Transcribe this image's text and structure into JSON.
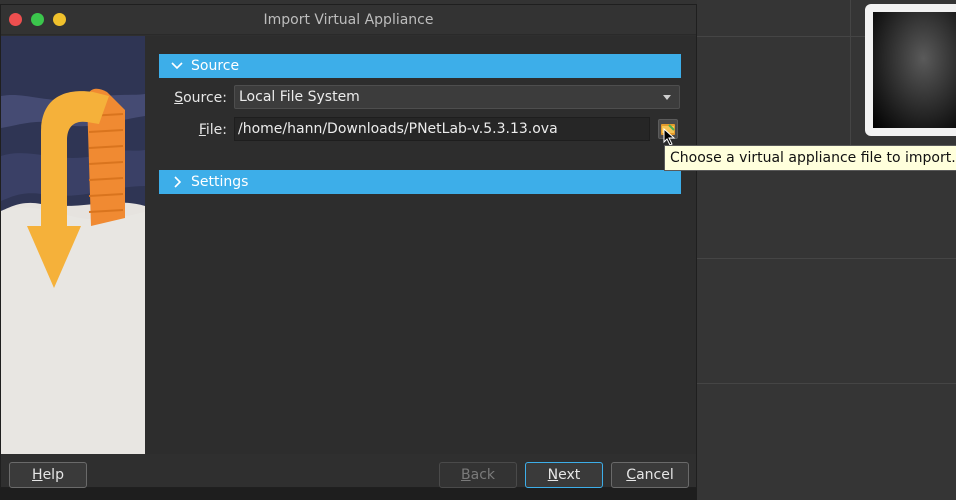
{
  "window": {
    "title": "Import Virtual Appliance"
  },
  "sections": {
    "source": {
      "header": "Source",
      "source_label": "Source:",
      "source_label_mnemonic": "S",
      "source_label_rest": "ource:",
      "source_value": "Local File System",
      "file_label": "File:",
      "file_label_mnemonic": "F",
      "file_label_rest": "ile:",
      "file_value": "/home/hann/Downloads/PNetLab-v.5.3.13.ova"
    },
    "settings": {
      "header": "Settings"
    }
  },
  "tooltip": {
    "text": "Choose a virtual appliance file to import..."
  },
  "buttons": {
    "help_mnemonic": "H",
    "help_rest": "elp",
    "back_mnemonic": "B",
    "back_rest": "ack",
    "next_mnemonic": "N",
    "next_rest": "ext",
    "cancel_mnemonic": "C",
    "cancel_rest": "ancel"
  },
  "colors": {
    "accent": "#3daee9",
    "tooltip_bg": "#ffffdc",
    "close": "#ee4f4f",
    "maximize": "#3bc64c",
    "minimize": "#f0c12c"
  },
  "icons": {
    "section_expanded": "chevron-down-icon",
    "section_collapsed": "chevron-right-icon",
    "browse": "folder-browse-icon"
  }
}
